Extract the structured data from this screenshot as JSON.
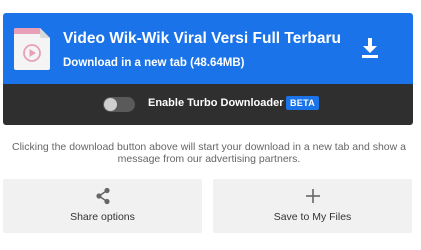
{
  "download": {
    "title": "Video Wik-Wik Viral Versi Full Terbaru",
    "subtitle": "Download in a new tab (48.64MB)",
    "file_icon": "video-file-icon",
    "download_icon": "download-arrow-icon"
  },
  "turbo": {
    "label": "Enable Turbo Downloader",
    "badge": "BETA",
    "enabled": false
  },
  "notice": "Clicking the download button above will start your download in a new tab and show a message from our advertising partners.",
  "actions": {
    "share_label": "Share options",
    "share_icon": "share-icon",
    "save_label": "Save to My Files",
    "save_icon": "plus-icon"
  },
  "colors": {
    "primary": "#1a73e8",
    "dark_bar": "#2f2f2f",
    "file_icon_accent": "#e8a0b8"
  }
}
